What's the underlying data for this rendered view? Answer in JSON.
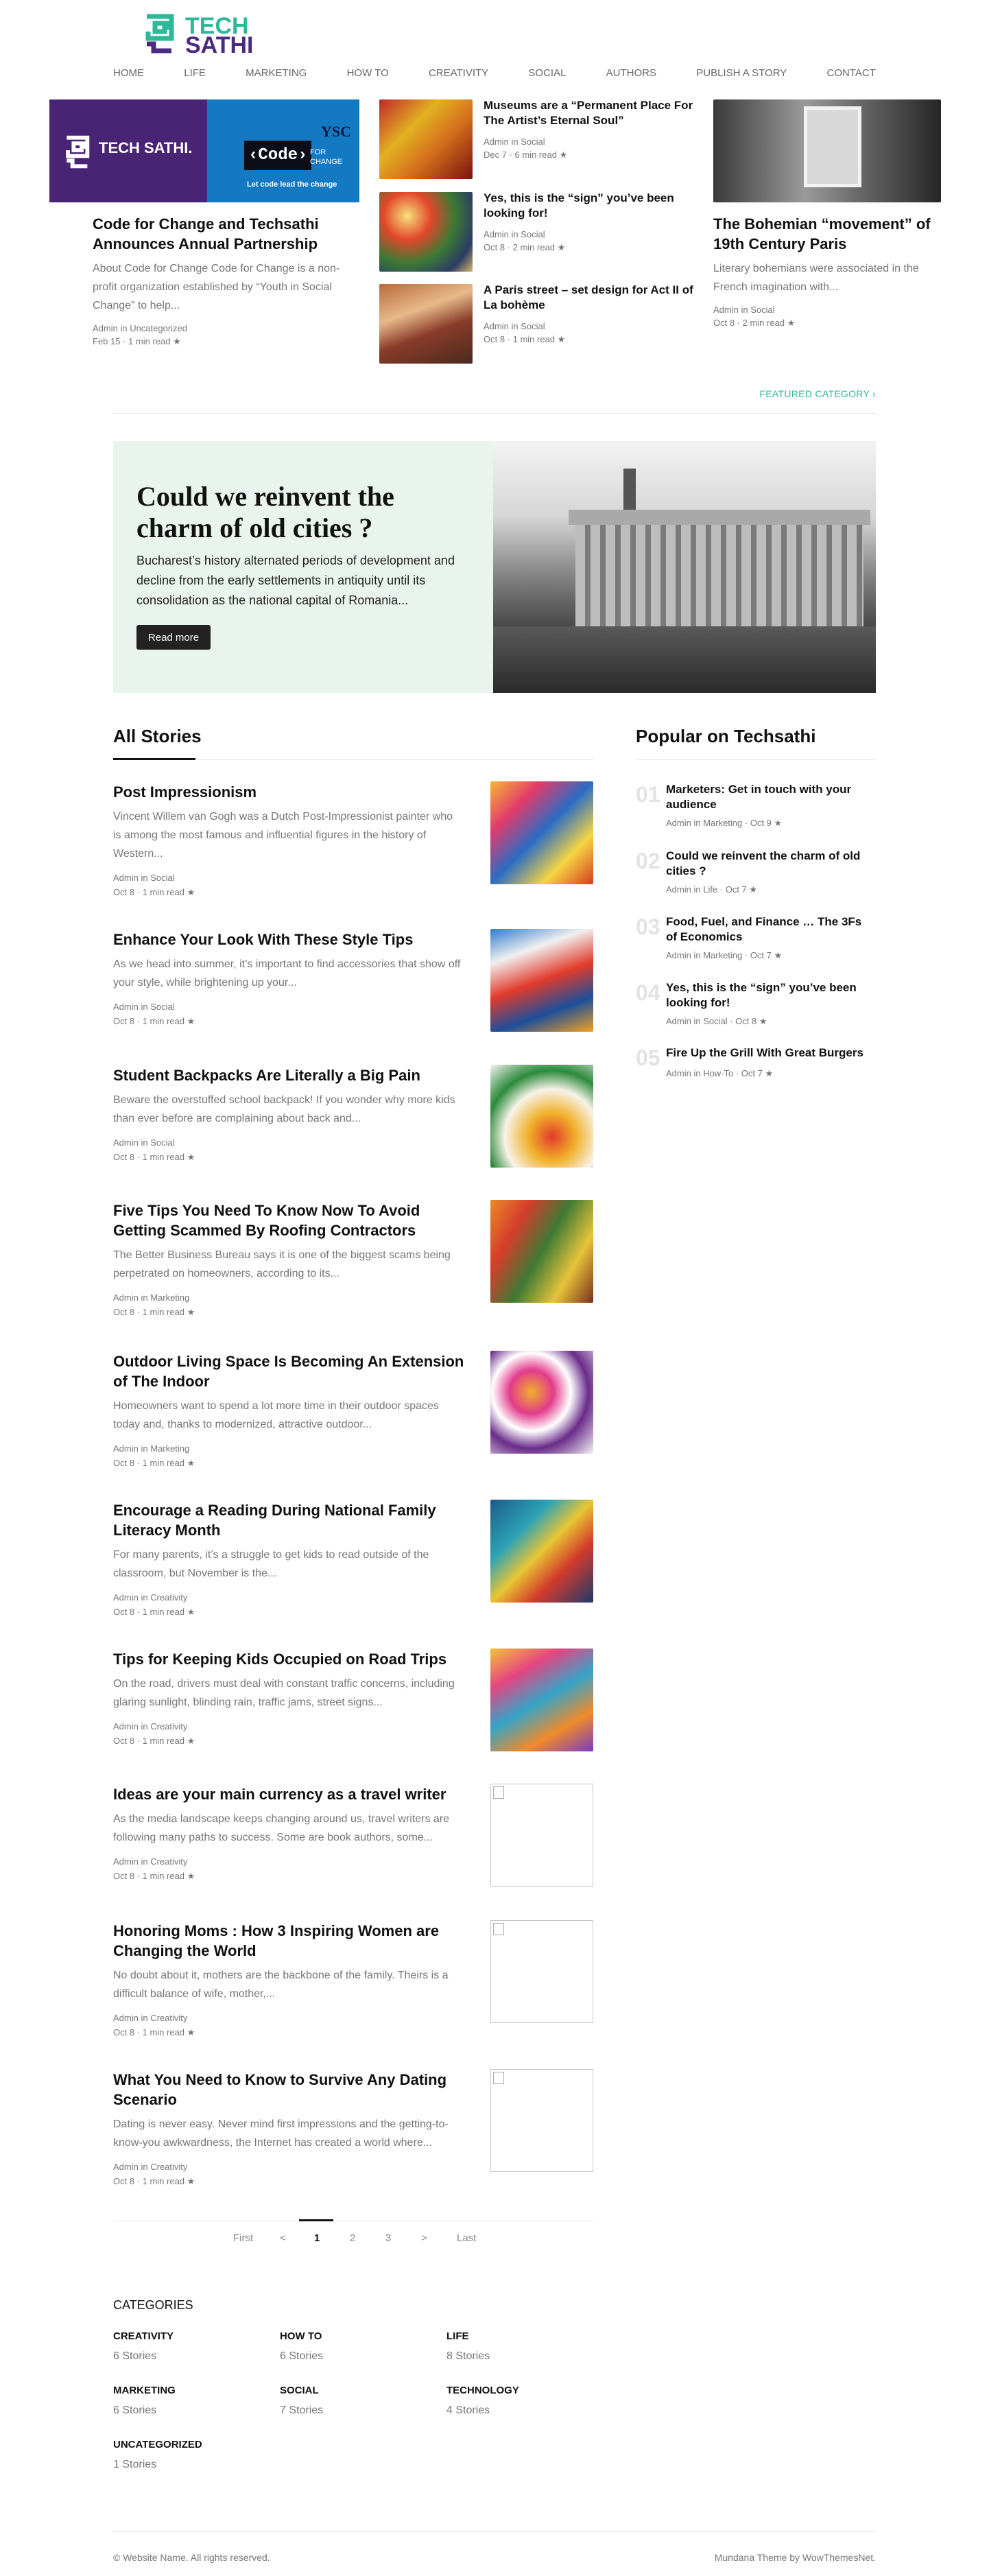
{
  "brand": {
    "line1": "TECH",
    "line2": "SATHI",
    "accent": "#2bb99a",
    "purple": "#4b2a83"
  },
  "nav": [
    "HOME",
    "LIFE",
    "MARKETING",
    "HOW TO",
    "CREATIVITY",
    "SOCIAL",
    "AUTHORS",
    "PUBLISH A STORY",
    "CONTACT"
  ],
  "featured": {
    "main": {
      "title": "Code for Change and Techsathi Announces Annual Partnership",
      "excerpt": "About Code for Change Code for Change is a non-profit organization established by “Youth in Social Change” to help...",
      "author": "Admin in Uncategorized",
      "date": "Feb 15 · 1 min read",
      "image_text": {
        "logo": "TECH SATHI.",
        "code": "‹Code›",
        "for": "FOR CHANGE",
        "tag": "Let code lead the change",
        "ysc": "YSC"
      }
    },
    "middle": [
      {
        "title": "Museums are a “Permanent Place For The Artist’s Eternal Soul”",
        "author": "Admin in Social",
        "date": "Dec 7 · 6 min read"
      },
      {
        "title": "Yes, this is the “sign” you’ve been looking for!",
        "author": "Admin in Social",
        "date": "Oct 8 · 2 min read"
      },
      {
        "title": "A Paris street – set design for Act II of La bohème",
        "author": "Admin in Social",
        "date": "Oct 8 · 1 min read"
      }
    ],
    "right": {
      "title": "The Bohemian “movement” of 19th Century Paris",
      "excerpt": "Literary bohemians were associated in the French imagination with...",
      "author": "Admin in Social",
      "date": "Oct 8 · 2 min read"
    },
    "link": "FEATURED CATEGORY ›"
  },
  "banner": {
    "title": "Could we reinvent the charm of old cities ?",
    "excerpt": "Bucharest’s history alternated periods of development and decline from the early settlements in antiquity until its consolidation as the national capital of Romania...",
    "button": "Read more"
  },
  "all_stories": {
    "heading": "All Stories",
    "items": [
      {
        "title": "Post Impressionism",
        "excerpt": "Vincent Willem van Gogh was a Dutch Post-Impressionist painter who is among the most famous and influential figures in the history of Western...",
        "author": "Admin in Social",
        "date": "Oct 8 · 1 min read"
      },
      {
        "title": "Enhance Your Look With These Style Tips",
        "excerpt": "As we head into summer, it’s important to find accessories that show off your style, while brightening up your...",
        "author": "Admin in Social",
        "date": "Oct 8 · 1 min read"
      },
      {
        "title": "Student Backpacks Are Literally a Big Pain",
        "excerpt": "Beware the overstuffed school backpack! If you wonder why more kids than ever before are complaining about back and...",
        "author": "Admin in Social",
        "date": "Oct 8 · 1 min read"
      },
      {
        "title": "Five Tips You Need To Know Now To Avoid Getting Scammed By Roofing Contractors",
        "excerpt": "The Better Business Bureau says it is one of the biggest scams being perpetrated on homeowners, according to its...",
        "author": "Admin in Marketing",
        "date": "Oct 8 · 1 min read"
      },
      {
        "title": "Outdoor Living Space Is Becoming An Extension of The Indoor",
        "excerpt": "Homeowners want to spend a lot more time in their outdoor spaces today and, thanks to modernized, attractive outdoor...",
        "author": "Admin in Marketing",
        "date": "Oct 8 · 1 min read"
      },
      {
        "title": "Encourage a Reading During National Family Literacy Month",
        "excerpt": "For many parents, it’s a struggle to get kids to read outside of the classroom, but November is the...",
        "author": "Admin in Creativity",
        "date": "Oct 8 · 1 min read"
      },
      {
        "title": "Tips for Keeping Kids Occupied on Road Trips",
        "excerpt": "On the road, drivers must deal with constant traffic concerns, including glaring sunlight, blinding rain, traffic jams, street signs...",
        "author": "Admin in Creativity",
        "date": "Oct 8 · 1 min read"
      },
      {
        "title": "Ideas are your main currency as a travel writer",
        "excerpt": "As the media landscape keeps changing around us, travel writers are following many paths to success. Some are book authors, some...",
        "author": "Admin in Creativity",
        "date": "Oct 8 · 1 min read"
      },
      {
        "title": "Honoring Moms : How 3 Inspiring Women are Changing the World",
        "excerpt": "No doubt about it, mothers are the backbone of the family. Theirs is a difficult balance of wife, mother,...",
        "author": "Admin in Creativity",
        "date": "Oct 8 · 1 min read"
      },
      {
        "title": "What You Need to Know to Survive Any Dating Scenario",
        "excerpt": "Dating is never easy. Never mind first impressions and the getting-to-know-you awkwardness, the Internet has created a world where...",
        "author": "Admin in Creativity",
        "date": "Oct 8 · 1 min read"
      }
    ]
  },
  "popular": {
    "heading": "Popular on Techsathi",
    "items": [
      {
        "num": "01",
        "title": "Marketers: Get in touch with your audience",
        "meta": "Admin in Marketing · Oct 9"
      },
      {
        "num": "02",
        "title": "Could we reinvent the charm of old cities ?",
        "meta": "Admin in Life · Oct 7"
      },
      {
        "num": "03",
        "title": "Food, Fuel, and Finance … The 3Fs of Economics",
        "meta": "Admin in Marketing · Oct 7"
      },
      {
        "num": "04",
        "title": "Yes, this is the “sign” you’ve been looking for!",
        "meta": "Admin in Social · Oct 8"
      },
      {
        "num": "05",
        "title": "Fire Up the Grill With Great Burgers",
        "meta": "Admin in How-To · Oct 7"
      }
    ]
  },
  "pagination": {
    "first": "First",
    "prev": "<",
    "pages": [
      "1",
      "2",
      "3"
    ],
    "current": "1",
    "next": ">",
    "last": "Last"
  },
  "categories": {
    "heading": "CATEGORIES",
    "items": [
      {
        "name": "CREATIVITY",
        "count": "6 Stories"
      },
      {
        "name": "HOW TO",
        "count": "6 Stories"
      },
      {
        "name": "LIFE",
        "count": "8 Stories"
      },
      {
        "name": "MARKETING",
        "count": "6 Stories"
      },
      {
        "name": "SOCIAL",
        "count": "7 Stories"
      },
      {
        "name": "TECHNOLOGY",
        "count": "4 Stories"
      },
      {
        "name": "UNCATEGORIZED",
        "count": "1 Stories"
      }
    ]
  },
  "footer": {
    "left": "© Website Name. All rights reserved.",
    "right": "Mundana Theme by WowThemesNet."
  }
}
